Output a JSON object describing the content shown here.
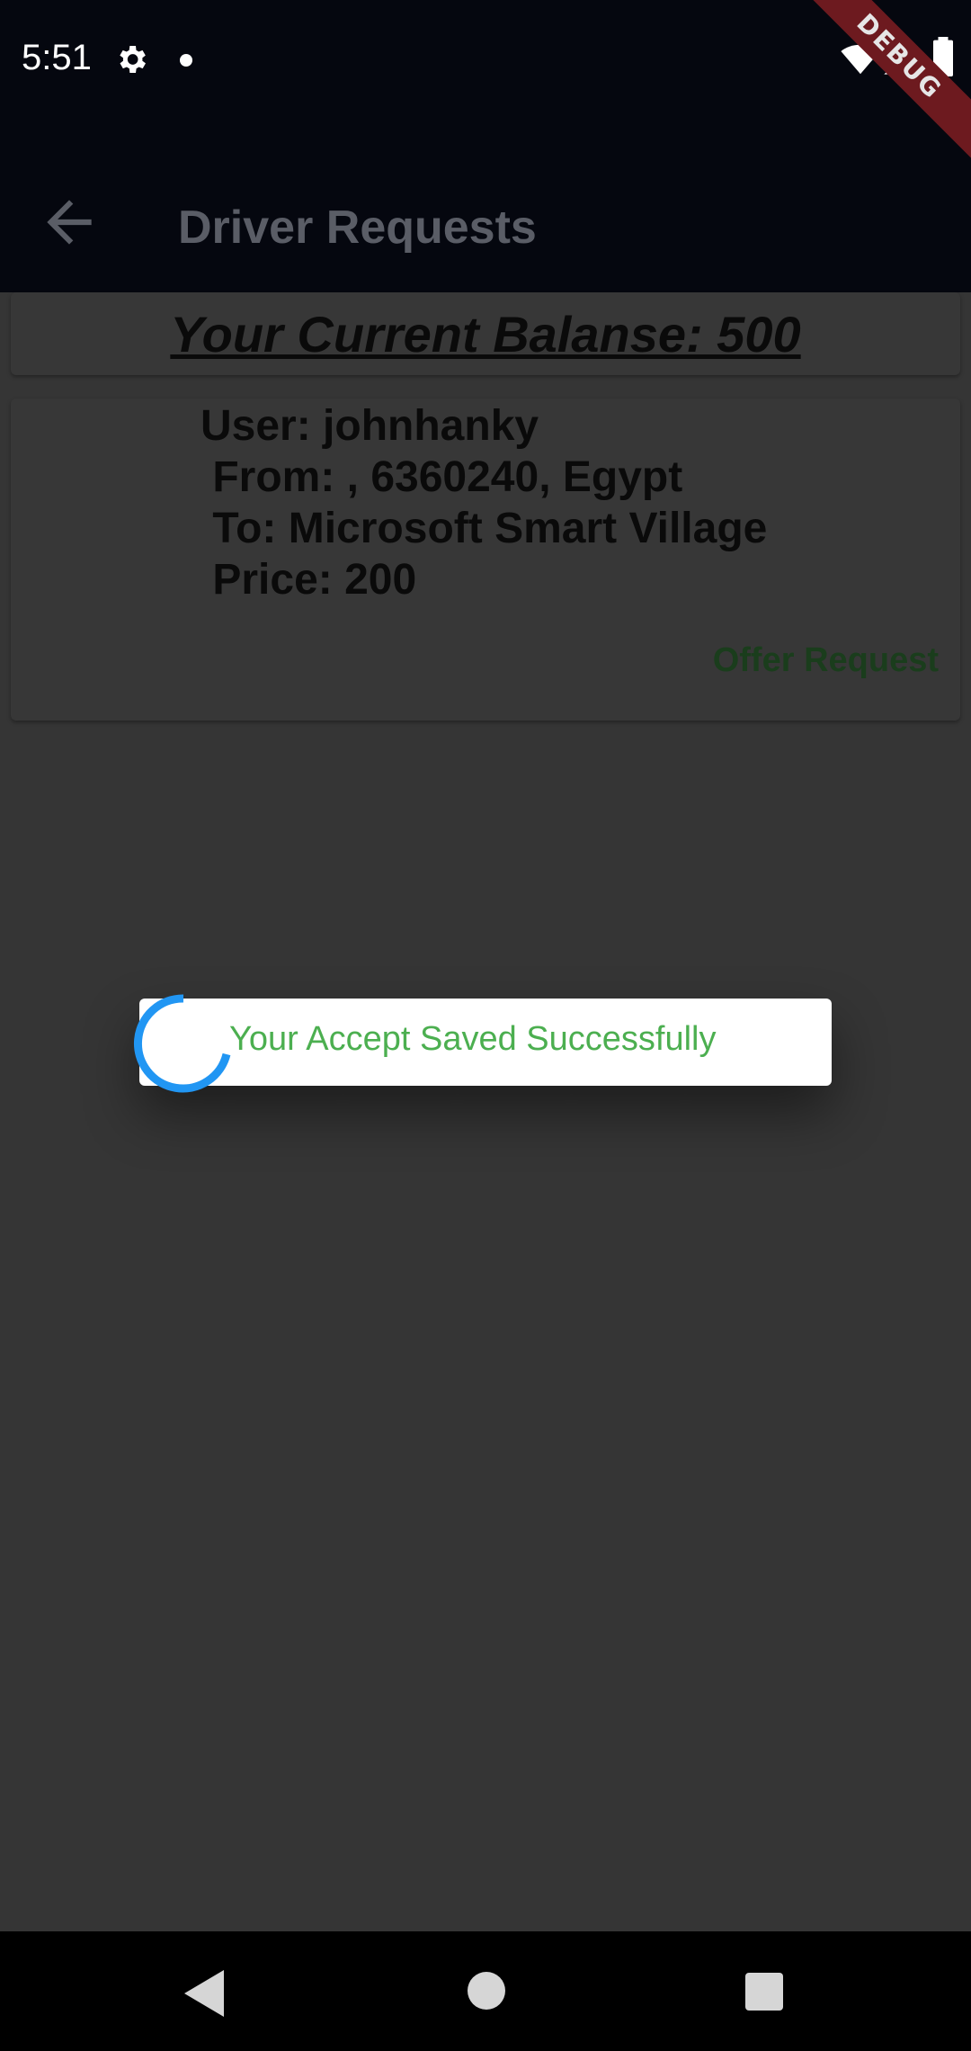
{
  "status_bar": {
    "time": "5:51",
    "icons": [
      "gear-icon",
      "notification-dot",
      "wifi-icon",
      "signal-icon",
      "battery-icon"
    ]
  },
  "debug_banner": "DEBUG",
  "app_bar": {
    "title": "Driver Requests",
    "back_icon": "arrow-back-icon"
  },
  "balance": {
    "text": "Your Current Balanse: 500"
  },
  "request": {
    "user": "User: johnhanky",
    "from": " From: , 6360240, Egypt",
    "to": " To: Microsoft Smart Village",
    "price": " Price: 200",
    "action_label": "Offer Request"
  },
  "toast": {
    "message": "Your Accept Saved Successfully"
  },
  "nav_bar": {
    "icons": [
      "nav-back-icon",
      "nav-home-icon",
      "nav-recents-icon"
    ]
  },
  "colors": {
    "app_bar_bg": "#05070f",
    "body_bg": "#353535",
    "toast_text": "#4caf50",
    "spinner": "#2196f3",
    "offer_text": "#1a3d1c"
  }
}
